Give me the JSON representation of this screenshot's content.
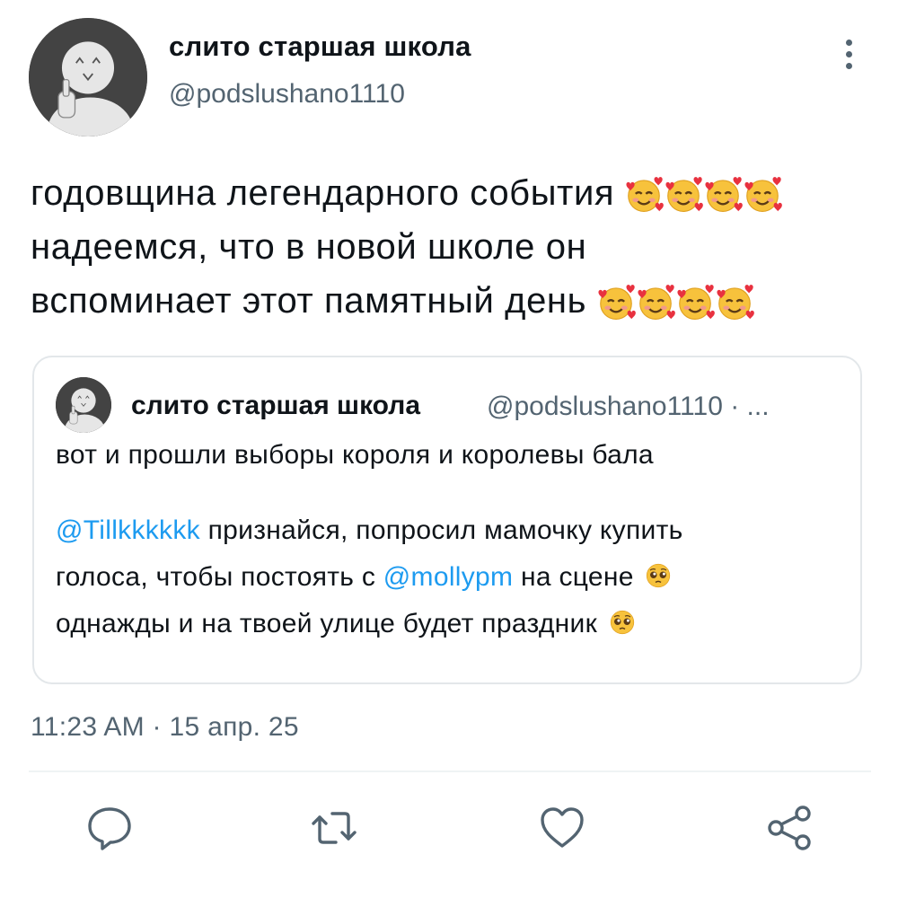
{
  "tweet": {
    "author_name": "слито старшая школа",
    "author_handle": "@podslushano1110",
    "avatar_icon": "avatar-icon",
    "more_icon": "more-vertical-icon",
    "text_lines": [
      "годовщина легендарного события",
      "надеемся, что в новой школе он",
      "вспоминает этот памятный день"
    ],
    "emoji_name": "smiling-face-with-hearts-emoji",
    "timestamp": "11:23 AM · 15 апр. 25"
  },
  "quote": {
    "author_name": "слито старшая школа",
    "author_handle": "@podslushano1110 · ...",
    "line1": "вот и прошли выборы короля и королевы бала",
    "line2_mention": "@Tillkkkkkk",
    "line2_rest": " признайся, попросил мамочку купить",
    "line3_start": "голоса, чтобы постоять с ",
    "line3_mention": "@mollypm",
    "line3_end": " на сцене",
    "line4": "однажды и на твоей улице будет праздник",
    "emoji_name": "pleading-face-emoji"
  },
  "actions": [
    {
      "name": "reply-icon"
    },
    {
      "name": "retweet-icon"
    },
    {
      "name": "like-icon"
    },
    {
      "name": "share-icon"
    }
  ],
  "colors": {
    "link": "#1d9bf0",
    "secondary_text": "#536471",
    "primary_text": "#0f1419",
    "avatar_bg": "#434343"
  }
}
